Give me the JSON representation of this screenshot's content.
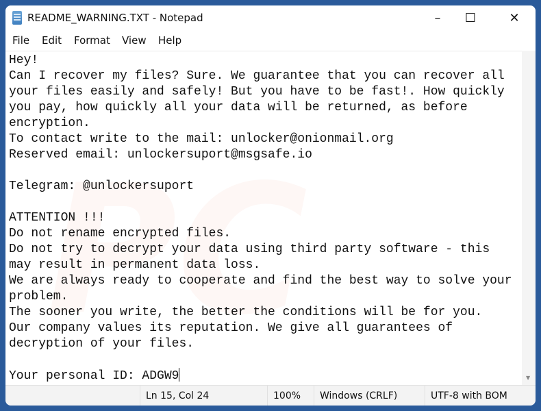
{
  "window": {
    "title": "README_WARNING.TXT - Notepad",
    "icon": "notepad-icon"
  },
  "controls": {
    "minimize": "–",
    "maximize": "☐",
    "close": "✕"
  },
  "menu": [
    "File",
    "Edit",
    "Format",
    "View",
    "Help"
  ],
  "content": {
    "lines": [
      "Hey!",
      "Can I recover my files? Sure. We guarantee that you can recover all",
      "your files easily and safely! But you have to be fast!. How quickly",
      "you pay, how quickly all your data will be returned, as before",
      "encryption.",
      "To contact write to the mail: unlocker@onionmail.org",
      "Reserved email: unlockersuport@msgsafe.io",
      "",
      "Telegram: @unlockersuport",
      "",
      "ATTENTION !!!",
      "Do not rename encrypted files.",
      "Do not try to decrypt your data using third party software - this",
      "may result in permanent data loss.",
      "We are always ready to cooperate and find the best way to solve your",
      "problem.",
      "The sooner you write, the better the conditions will be for you.",
      "Our company values its reputation. We give all guarantees of",
      "decryption of your files.",
      "",
      "Your personal ID: ADGW9"
    ]
  },
  "status": {
    "position": "Ln 15, Col 24",
    "zoom": "100%",
    "line_ending": "Windows (CRLF)",
    "encoding": "UTF-8 with BOM"
  }
}
